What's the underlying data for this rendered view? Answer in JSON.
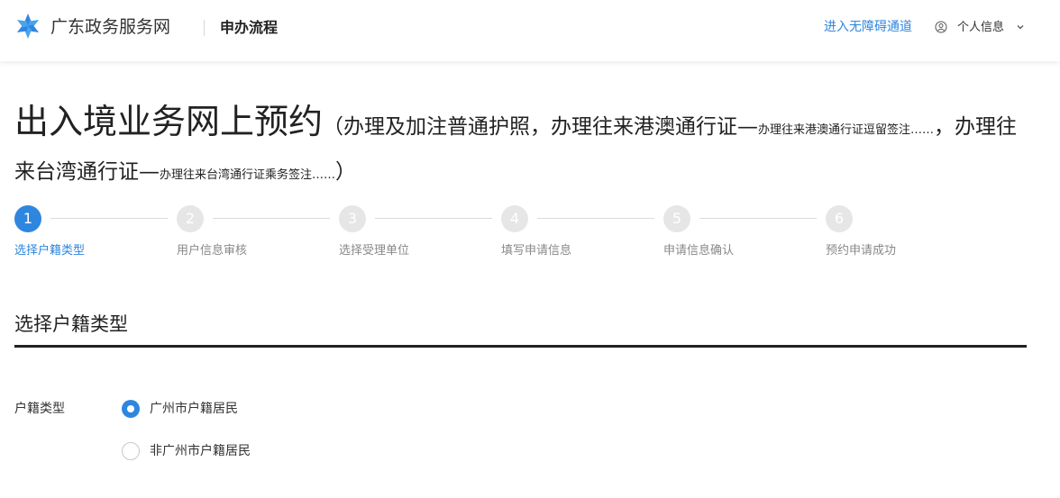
{
  "header": {
    "brand": "广东政务服务网",
    "subtitle": "申办流程",
    "accessibility_link": "进入无障碍通道",
    "user_menu": "个人信息",
    "brand_color": "#2f86df"
  },
  "title": {
    "main": "出入境业务网上预约",
    "paren_open": "（办理及加注普通护照，办理往来港澳通行证—",
    "note_1": "办理往来港澳通行证逗留签注……",
    "mid_1": "，办理往来台湾通行证—",
    "note_2": "办理往来台湾通行证乘务签注……",
    "paren_close": "）"
  },
  "steps": [
    {
      "num": "1",
      "label": "选择户籍类型",
      "active": true
    },
    {
      "num": "2",
      "label": "用户信息审核",
      "active": false
    },
    {
      "num": "3",
      "label": "选择受理单位",
      "active": false
    },
    {
      "num": "4",
      "label": "填写申请信息",
      "active": false
    },
    {
      "num": "5",
      "label": "申请信息确认",
      "active": false
    },
    {
      "num": "6",
      "label": "预约申请成功",
      "active": false
    }
  ],
  "section": {
    "title": "选择户籍类型",
    "field_label": "户籍类型",
    "options": [
      {
        "label": "广州市户籍居民",
        "checked": true
      },
      {
        "label": "非广州市户籍居民",
        "checked": false
      }
    ]
  }
}
